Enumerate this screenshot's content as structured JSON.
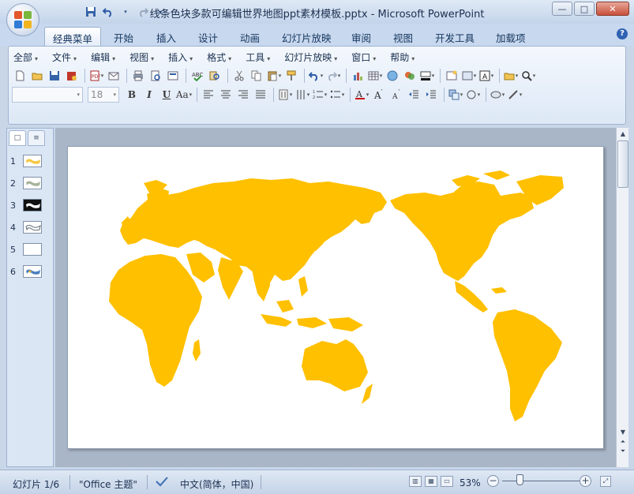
{
  "window": {
    "title": "线条色块多款可编辑世界地图ppt素材模板.pptx - Microsoft PowerPoint",
    "minimize": "—",
    "maximize": "□",
    "close": "✕"
  },
  "qat": {
    "save": "save-icon",
    "undo": "undo-icon",
    "redo": "redo-icon",
    "customize": "▾"
  },
  "tabs": [
    {
      "label": "经典菜单",
      "active": true
    },
    {
      "label": "开始"
    },
    {
      "label": "插入"
    },
    {
      "label": "设计"
    },
    {
      "label": "动画"
    },
    {
      "label": "幻灯片放映"
    },
    {
      "label": "审阅"
    },
    {
      "label": "视图"
    },
    {
      "label": "开发工具"
    },
    {
      "label": "加载项"
    }
  ],
  "menus": [
    "全部",
    "文件",
    "编辑",
    "视图",
    "插入",
    "格式",
    "工具",
    "幻灯片放映",
    "窗口",
    "帮助"
  ],
  "toolbar": {
    "font_name": "",
    "font_size": "18",
    "bold": "B",
    "italic": "I",
    "underline": "U",
    "case": "Aa",
    "text_box": "A"
  },
  "slides_panel": {
    "tab_slides": "□",
    "tab_outline": "≡",
    "slides": [
      {
        "num": "1",
        "thumb_color": "#f5c842"
      },
      {
        "num": "2",
        "thumb_color": "#a7b39a"
      },
      {
        "num": "3",
        "thumb_color": "#111111"
      },
      {
        "num": "4",
        "thumb_color": "#5f6a74"
      },
      {
        "num": "5",
        "thumb_color": "#ffffff"
      },
      {
        "num": "6",
        "thumb_color": "#4a7fbf"
      }
    ]
  },
  "map": {
    "color": "#ffc000"
  },
  "status": {
    "slide_info": "幻灯片 1/6",
    "theme": "\"Office 主题\"",
    "language": "中文(简体，中国)",
    "zoom": "53%"
  }
}
